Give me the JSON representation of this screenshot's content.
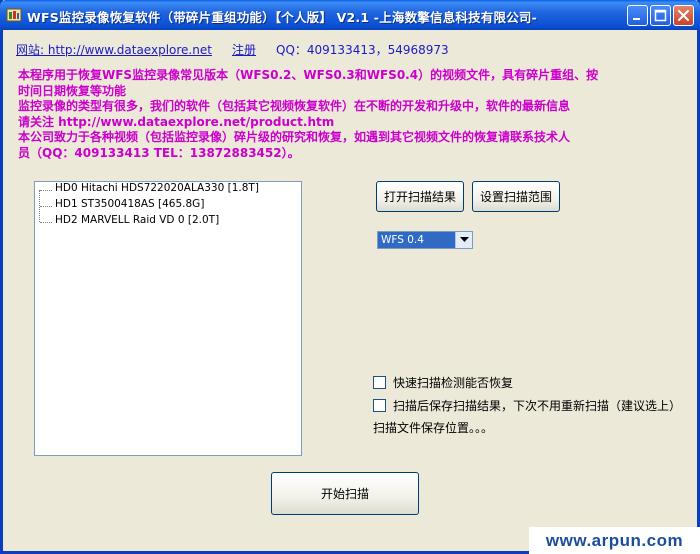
{
  "window": {
    "title": "WFS监控录像恢复软件（带碎片重组功能）【个人版】 V2.1  -上海数擎信息科技有限公司-"
  },
  "header": {
    "website_link": "网站: http://www.dataexplore.net",
    "register_link": "注册",
    "qq": "QQ：409133413，54968973"
  },
  "description": {
    "lines": [
      "本程序用于恢复WFS监控录像常见版本（WFS0.2、WFS0.3和WFS0.4）的视频文件，具有碎片重组、按",
      "时间日期恢复等功能",
      "监控录像的类型有很多，我们的软件（包括其它视频恢复软件）在不断的开发和升级中，软件的最新信息",
      "请关注 http://www.dataexplore.net/product.htm",
      "本公司致力于各种视频（包括监控录像）碎片级的研究和恢复，如遇到其它视频文件的恢复请联系技术人",
      "员（QQ：409133413 TEL：13872883452）。"
    ]
  },
  "drives": {
    "items": [
      {
        "id": "HD0",
        "label": "HD0  Hitachi HDS722020ALA330  [1.8T]"
      },
      {
        "id": "HD1",
        "label": "HD1  ST3500418AS  [465.8G]"
      },
      {
        "id": "HD2",
        "label": "HD2  MARVELL Raid VD 0  [2.0T]"
      }
    ]
  },
  "actions": {
    "open_result": "打开扫描结果",
    "set_range": "设置扫描范围",
    "start_scan": "开始扫描"
  },
  "version_select": {
    "selected": "WFS 0.4"
  },
  "options": {
    "quick_scan": "快速扫描检测能否恢复",
    "save_result": "扫描后保存扫描结果，下次不用重新扫描（建议选上）",
    "save_location": "扫描文件保存位置。。。"
  },
  "watermark": "www.arpun.com",
  "colors": {
    "titlebar": "#0A4FD2",
    "description_text": "#CC00CC",
    "link": "#1A1AC8",
    "selection": "#316AC5",
    "window_bg": "#ECE9D8"
  }
}
